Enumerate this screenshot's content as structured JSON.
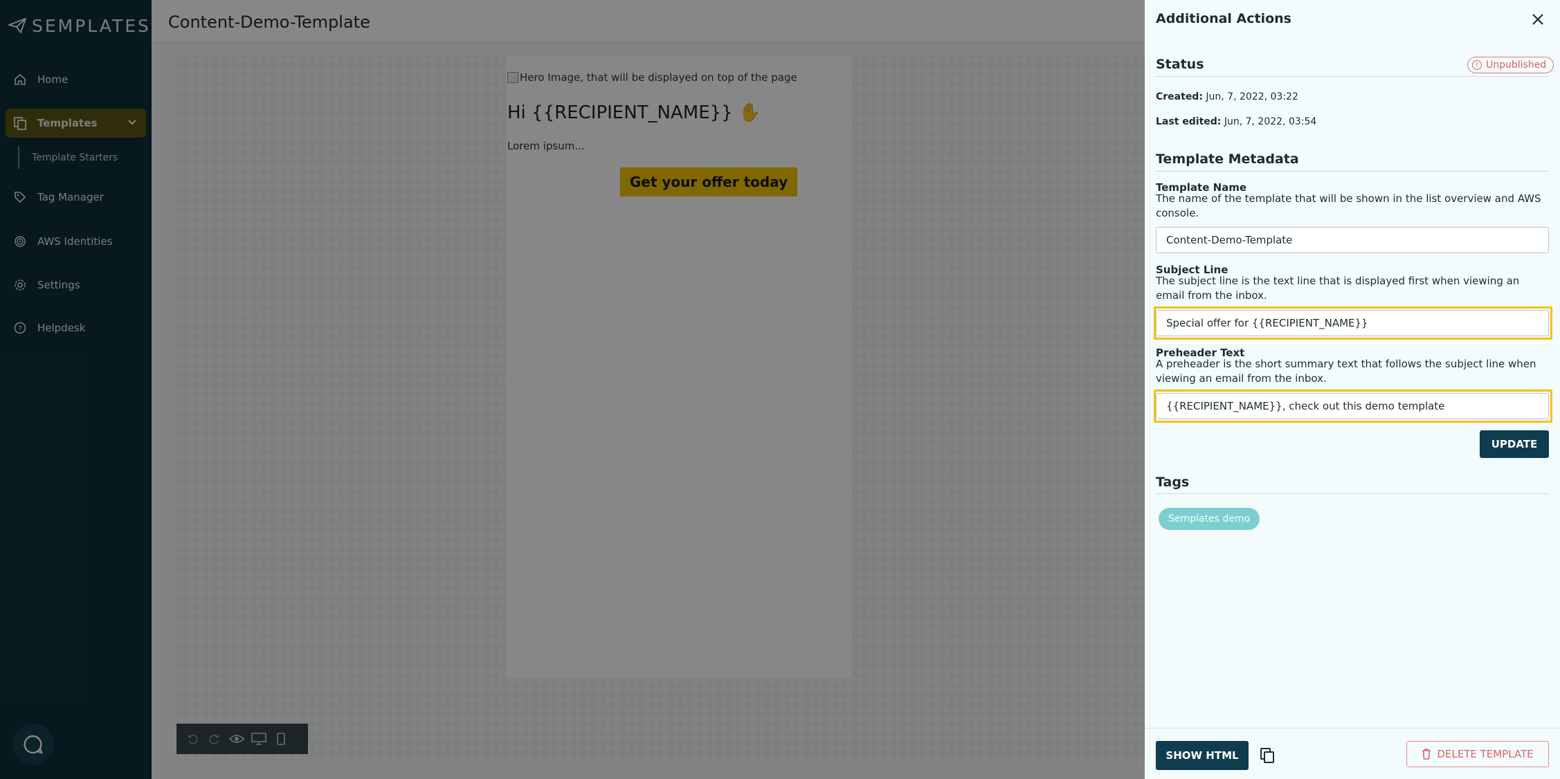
{
  "app": {
    "logo_text": "SEMPLATES"
  },
  "sidebar": {
    "items": [
      {
        "label": "Home",
        "icon": "home-icon"
      },
      {
        "label": "Templates",
        "icon": "templates-icon"
      },
      {
        "label": "Tag Manager",
        "icon": "tag-icon"
      },
      {
        "label": "AWS Identities",
        "icon": "fingerprint-icon"
      },
      {
        "label": "Settings",
        "icon": "gear-icon"
      },
      {
        "label": "Helpdesk",
        "icon": "help-icon"
      }
    ],
    "sub_item": "Template Starters"
  },
  "main": {
    "title": "Content-Demo-Template",
    "email": {
      "hero_alt": "Hero Image, that will be displayed on top of the page",
      "greeting": "Hi {{RECIPIENT_NAME}} ✋",
      "body": "Lorem ipsum...",
      "cta": "Get your offer today"
    }
  },
  "drawer": {
    "title": "Additional Actions",
    "status": {
      "heading": "Status",
      "badge": "Unpublished",
      "created_label": "Created:",
      "created_value": "Jun, 7, 2022, 03:22",
      "edited_label": "Last edited:",
      "edited_value": "Jun, 7, 2022, 03:54"
    },
    "metadata": {
      "heading": "Template Metadata",
      "name_label": "Template Name",
      "name_help": "The name of the template that will be shown in the list overview and AWS console.",
      "name_value": "Content-Demo-Template",
      "subject_label": "Subject Line",
      "subject_help": "The subject line is the text line that is displayed first when viewing an email from the inbox.",
      "subject_value": "Special offer for {{RECIPIENT_NAME}}",
      "preheader_label": "Preheader Text",
      "preheader_help": "A preheader is the short summary text that follows the subject line when viewing an email from the inbox.",
      "preheader_value": "{{RECIPIENT_NAME}}, check out this demo template",
      "update_label": "UPDATE"
    },
    "tags": {
      "heading": "Tags",
      "items": [
        "Semplates demo"
      ]
    },
    "footer": {
      "show_html": "SHOW HTML",
      "delete": "DELETE TEMPLATE"
    }
  },
  "colors": {
    "sidebar": "#0f2f3c",
    "accent": "#f2c200",
    "primary": "#0f3c4f",
    "danger": "#d96565",
    "tag": "#7ccfd0"
  }
}
